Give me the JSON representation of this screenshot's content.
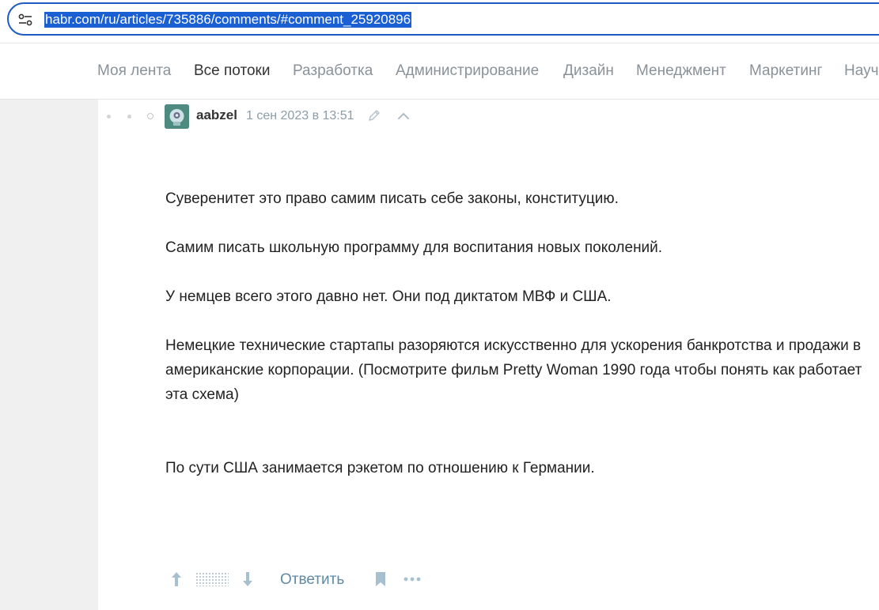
{
  "browser": {
    "url": "habr.com/ru/articles/735886/comments/#comment_25920896",
    "tune_icon": "tune-icon"
  },
  "nav": {
    "items": [
      {
        "label": "Моя лента",
        "active": false
      },
      {
        "label": "Все потоки",
        "active": true
      },
      {
        "label": "Разработка",
        "active": false
      },
      {
        "label": "Администрирование",
        "active": false
      },
      {
        "label": "Дизайн",
        "active": false
      },
      {
        "label": "Менеджмент",
        "active": false
      },
      {
        "label": "Маркетинг",
        "active": false
      },
      {
        "label": "Научпоп",
        "active": false
      }
    ]
  },
  "comment": {
    "author": "aabzel",
    "timestamp": "1 сен 2023 в 13:51",
    "paragraphs": [
      "Суверенитет это право самим писать себе законы, конституцию.",
      "Самим писать школьную программу для воспитания новых поколений.",
      "У немцев всего этого давно нет. Они под диктатом МВФ и США.",
      "Немецкие технические стартапы разоряются искусственно для ускорения банкротства и продажи в американские корпорации. (Посмотрите фильм Pretty Woman 1990 года чтобы понять как работает эта схема)",
      "По сути США занимается рэкетом по отношению к Германии."
    ],
    "footer": {
      "reply_label": "Ответить"
    }
  },
  "colors": {
    "accent": "#1a5fd3",
    "link": "#5e8aa6",
    "muted": "#8a9299"
  }
}
